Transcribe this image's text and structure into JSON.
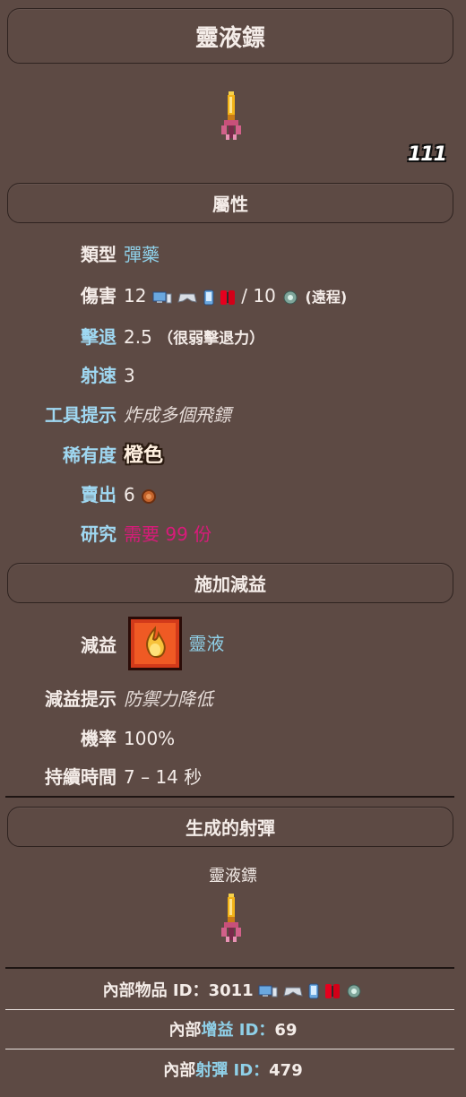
{
  "title": "靈液鏢",
  "rarity_badge": "111",
  "sections": {
    "attributes": "屬性",
    "debuff": "施加減益",
    "projectile": "生成的射彈"
  },
  "attributes": {
    "type": {
      "label_a": "類型",
      "value": "彈藥"
    },
    "damage": {
      "label_a": "傷害",
      "value_a": "12",
      "sep": "/",
      "value_b": "10",
      "suffix": "(遠程)"
    },
    "knockback": {
      "label_c1": "擊",
      "label_w1": "退",
      "value": "2.5",
      "paren": "（很弱擊退力）"
    },
    "speed": {
      "label_c1": "射",
      "label_w1": "速",
      "value": "3"
    },
    "tooltip": {
      "label_w1": "工具",
      "label_c1": "提示",
      "value": "炸成多個飛鏢"
    },
    "rarity": {
      "label_w1": "稀有",
      "label_c1": "度",
      "value": "橙色"
    },
    "sell": {
      "label_c1": "賣",
      "label_w1": "出",
      "value": "6"
    },
    "research": {
      "label": "研究",
      "value": "需要 99 份"
    }
  },
  "debuff": {
    "name_label": "減益",
    "name_value": "靈液",
    "tooltip_label": "減益提示",
    "tooltip_value": "防禦力降低",
    "chance_label": "機率",
    "chance_value": "100%",
    "duration_label": "持續時間",
    "duration_value": "7 – 14 秒"
  },
  "projectile": {
    "name": "靈液鏢"
  },
  "footer": {
    "item_id_prefix": "內部物品 ID：",
    "item_id": "3011",
    "buff_prefix_a": "內部",
    "buff_prefix_b": "增益",
    "buff_prefix_c": " ID：",
    "buff_id": "69",
    "proj_prefix_a": "內部",
    "proj_prefix_b": "射彈",
    "proj_prefix_c": " ID：",
    "proj_id": "479"
  },
  "colors": {
    "background": "#5d4a44",
    "link": "#9fd8f2",
    "research": "#d81b7a",
    "ichor": "#f2b319"
  }
}
